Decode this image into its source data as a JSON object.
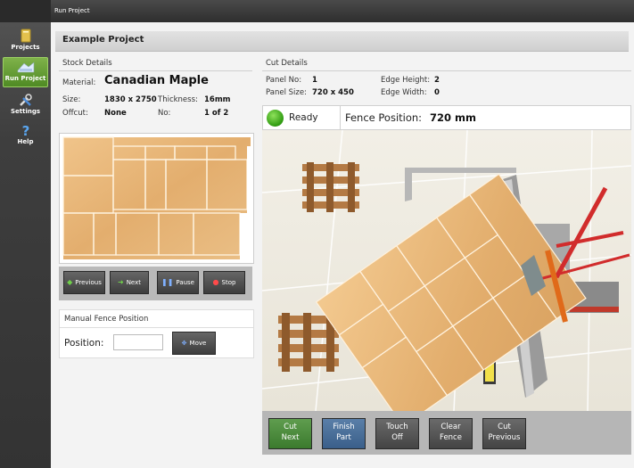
{
  "window": {
    "title": "Run Project"
  },
  "nav": [
    {
      "label": "Projects",
      "icon": "folder-icon",
      "active": false
    },
    {
      "label": "Run Project",
      "icon": "saw-icon",
      "active": true
    },
    {
      "label": "Settings",
      "icon": "tools-icon",
      "active": false
    },
    {
      "label": "Help",
      "icon": "question-icon",
      "active": false
    }
  ],
  "project": {
    "title": "Example Project"
  },
  "stock": {
    "heading": "Stock Details",
    "material_label": "Material:",
    "material_value": "Canadian Maple",
    "size_label": "Size:",
    "size_value": "1830 x 2750",
    "thickness_label": "Thickness:",
    "thickness_value": "16mm",
    "offcut_label": "Offcut:",
    "offcut_value": "None",
    "no_label": "No:",
    "no_value": "1 of 2"
  },
  "stock_controls": {
    "previous": "Previous",
    "next": "Next",
    "pause": "Pause",
    "stop": "Stop"
  },
  "manual_fence": {
    "title": "Manual Fence Position",
    "position_label": "Position:",
    "position_value": "",
    "move": "Move"
  },
  "cut": {
    "heading": "Cut Details",
    "panel_no_label": "Panel No:",
    "panel_no_value": "1",
    "panel_size_label": "Panel Size:",
    "panel_size_value": "720 x 450",
    "edge_height_label": "Edge Height:",
    "edge_height_value": "2",
    "edge_width_label": "Edge Width:",
    "edge_width_value": "0"
  },
  "status": {
    "state": "Ready",
    "state_color": "#2e9a10",
    "fence_label": "Fence Position:",
    "fence_value": "720 mm"
  },
  "actions": {
    "cut_next_1": "Cut",
    "cut_next_2": "Next",
    "finish_part_1": "Finish",
    "finish_part_2": "Part",
    "touch_off_1": "Touch",
    "touch_off_2": "Off",
    "clear_fence_1": "Clear",
    "clear_fence_2": "Fence",
    "cut_previous_1": "Cut",
    "cut_previous_2": "Previous"
  },
  "colors": {
    "active_nav": "#5f9d4f",
    "cut_next": "#3b7a2e",
    "finish_part": "#3a5f8a",
    "wood": "#e8b878"
  }
}
